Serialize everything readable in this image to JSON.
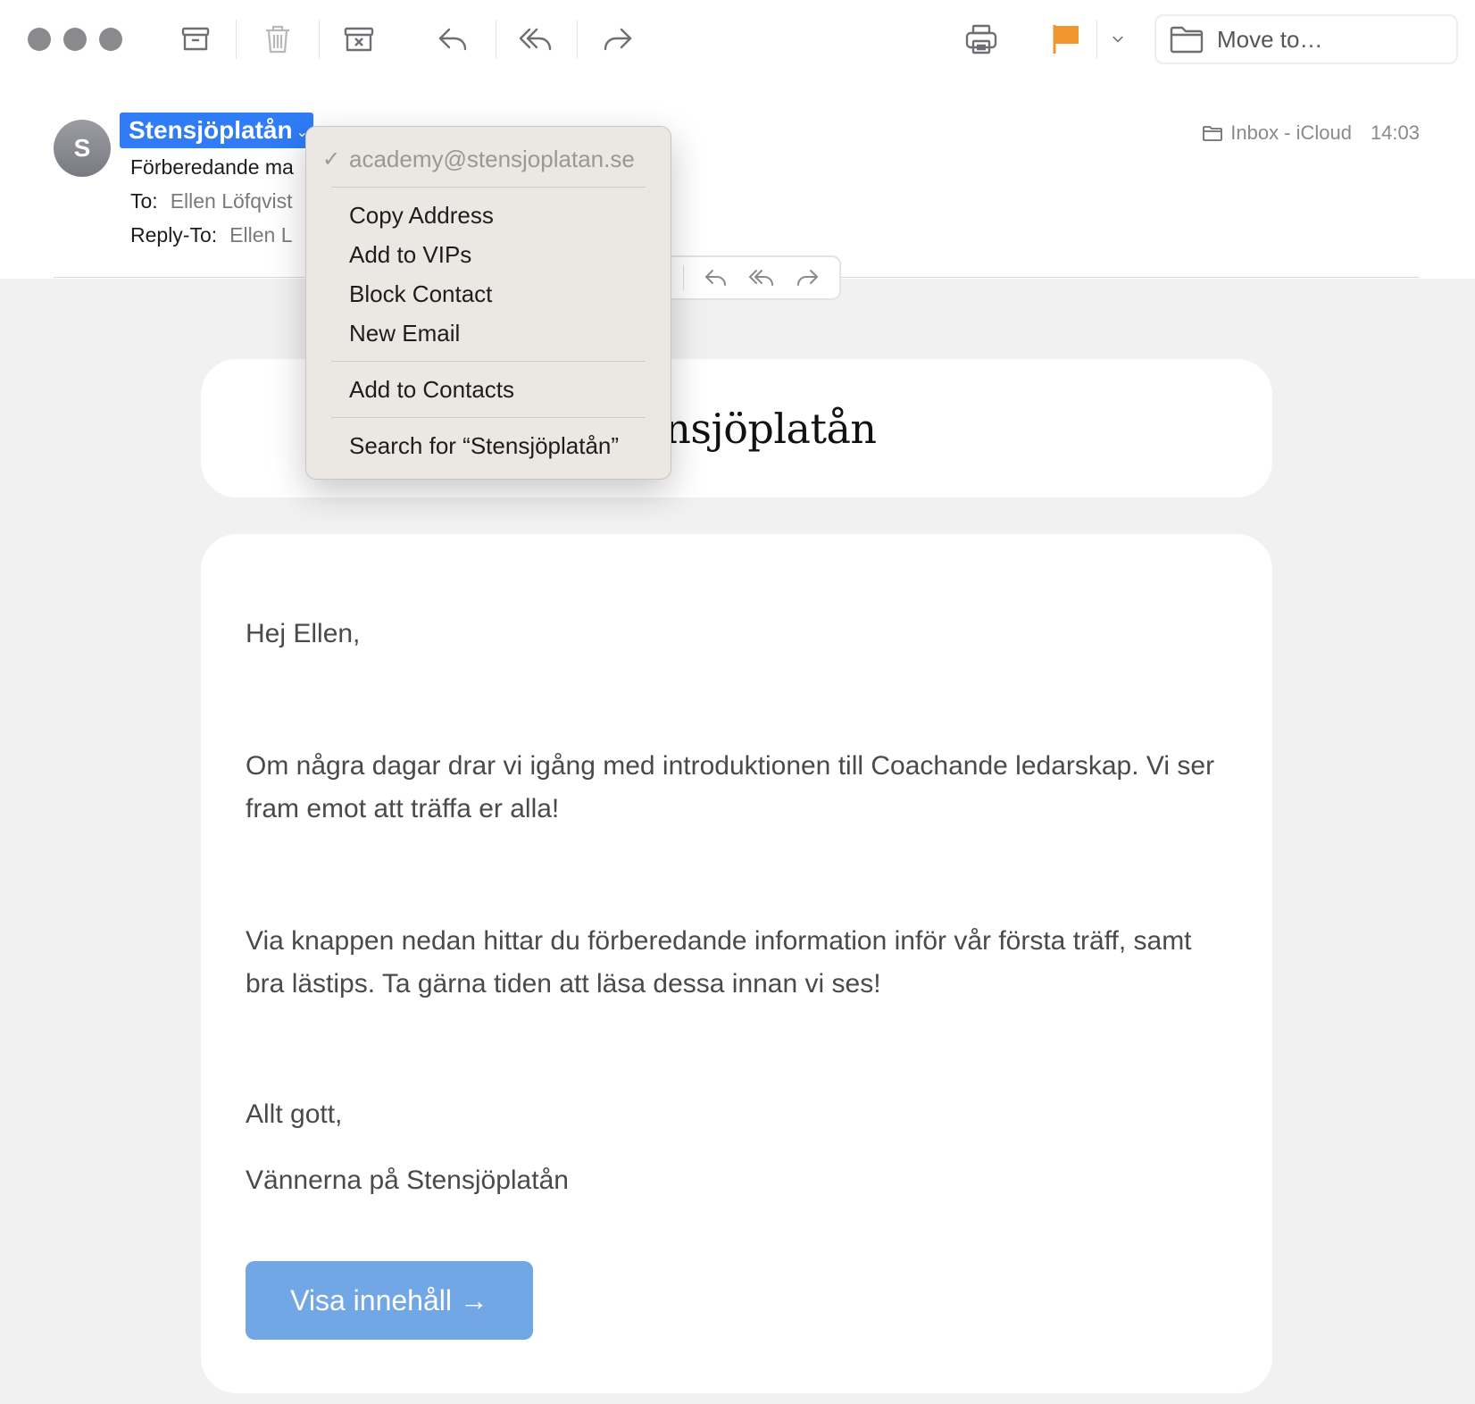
{
  "toolbar": {
    "move_to_label": "Move to…",
    "flag_color": "#f0962e"
  },
  "header": {
    "avatar_initial": "S",
    "sender_name": "Stensjöplatån",
    "subject": "Förberedande ma",
    "to_label": "To:",
    "to_value": "Ellen Löfqvist",
    "reply_to_label": "Reply-To:",
    "reply_to_value": "Ellen L",
    "mailbox": "Inbox - iCloud",
    "time": "14:03"
  },
  "context_menu": {
    "address": "academy@stensjoplatan.se",
    "items_group1": [
      "Copy Address",
      "Add to VIPs",
      "Block Contact",
      "New Email"
    ],
    "items_group2": [
      "Add to Contacts"
    ],
    "items_group3": [
      "Search for “Stensjöplatån”"
    ]
  },
  "email": {
    "logo_text": "Stensjöplatån",
    "greeting": "Hej Ellen,",
    "paragraph1": "Om några dagar drar vi igång med introduktionen till Coachande ledarskap. Vi ser fram emot att träffa er alla!",
    "paragraph2": "Via knappen nedan hittar du förberedande information inför vår första träff, samt bra lästips. Ta gärna tiden att läsa dessa innan vi ses!",
    "closing": "Allt gott,",
    "signature": "Vännerna på Stensjöplatån",
    "cta_label": "Visa innehåll →",
    "cta_color": "#72a7e6"
  }
}
